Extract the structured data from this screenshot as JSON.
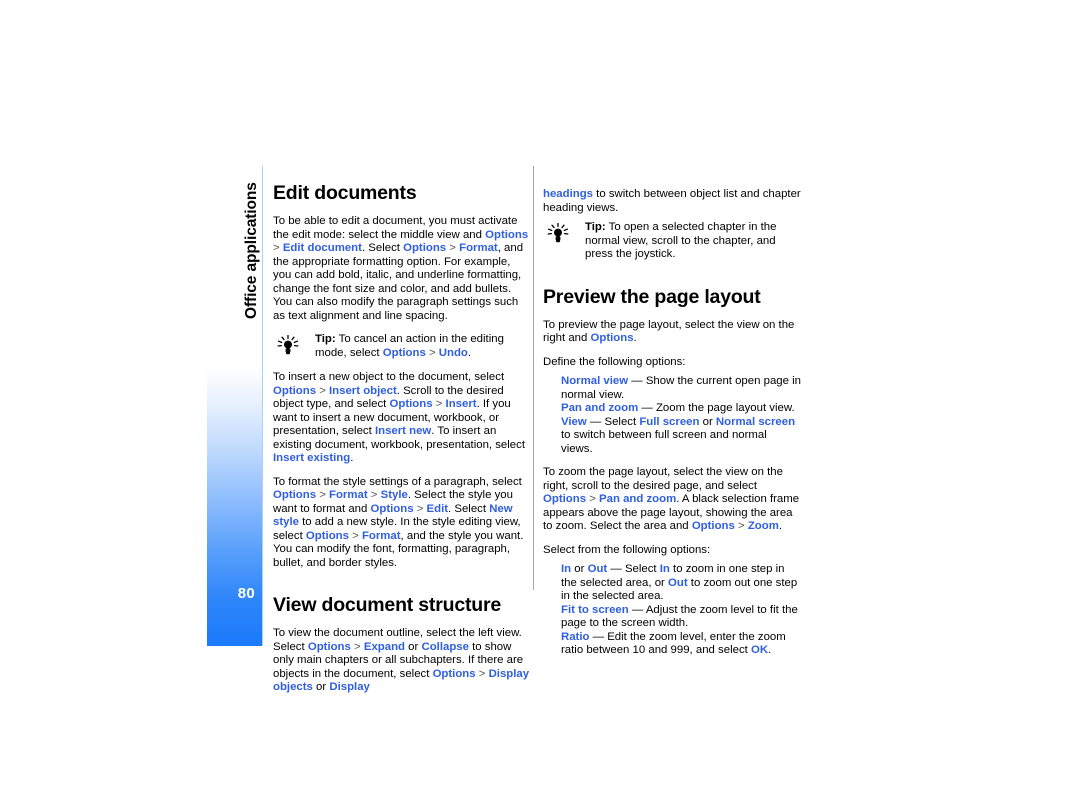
{
  "page": {
    "number": "80",
    "chapter": "Office applications",
    "accent_color": "#2f5fe0",
    "bar_color": "#1a7afc",
    "rule_left_color": "#a8d2f5",
    "rule_mid_color": "#a6a6a6"
  },
  "left_column": {
    "heading1": "Edit documents",
    "p1": [
      {
        "t": "To be able to edit a document, you must activate the edit mode: select the middle view and ",
        "s": "plain"
      },
      {
        "t": "Options",
        "s": "link"
      },
      {
        "t": " > ",
        "s": "gt"
      },
      {
        "t": "Edit document",
        "s": "link"
      },
      {
        "t": ". Select ",
        "s": "plain"
      },
      {
        "t": "Options",
        "s": "link"
      },
      {
        "t": " > ",
        "s": "gt"
      },
      {
        "t": "Format",
        "s": "link"
      },
      {
        "t": ", and the appropriate formatting option. For example, you can add bold, italic, and underline formatting, change the font size and color, and add bullets. You can also modify the paragraph settings such as text alignment and line spacing.",
        "s": "plain"
      }
    ],
    "tip1": [
      {
        "t": "Tip:",
        "s": "bold"
      },
      {
        "t": " To cancel an action in the editing mode, select ",
        "s": "plain"
      },
      {
        "t": "Options",
        "s": "link"
      },
      {
        "t": " > ",
        "s": "gt"
      },
      {
        "t": "Undo",
        "s": "link"
      },
      {
        "t": ".",
        "s": "plain"
      }
    ],
    "p2": [
      {
        "t": "To insert a new object to the document, select ",
        "s": "plain"
      },
      {
        "t": "Options",
        "s": "link"
      },
      {
        "t": " > ",
        "s": "gt"
      },
      {
        "t": "Insert object",
        "s": "link"
      },
      {
        "t": ". Scroll to the desired object type, and select ",
        "s": "plain"
      },
      {
        "t": "Options",
        "s": "link"
      },
      {
        "t": " > ",
        "s": "gt"
      },
      {
        "t": "Insert",
        "s": "link"
      },
      {
        "t": ". If you want to insert a new document, workbook, or presentation, select ",
        "s": "plain"
      },
      {
        "t": "Insert new",
        "s": "link"
      },
      {
        "t": ". To insert an existing document, workbook, presentation, select ",
        "s": "plain"
      },
      {
        "t": "Insert existing",
        "s": "link"
      },
      {
        "t": ".",
        "s": "plain"
      }
    ],
    "p3": [
      {
        "t": "To format the style settings of a paragraph, select ",
        "s": "plain"
      },
      {
        "t": "Options",
        "s": "link"
      },
      {
        "t": " > ",
        "s": "gt"
      },
      {
        "t": "Format",
        "s": "link"
      },
      {
        "t": " > ",
        "s": "gt"
      },
      {
        "t": "Style",
        "s": "link"
      },
      {
        "t": ". Select the style you want to format and ",
        "s": "plain"
      },
      {
        "t": "Options",
        "s": "link"
      },
      {
        "t": " > ",
        "s": "gt"
      },
      {
        "t": "Edit",
        "s": "link"
      },
      {
        "t": ". Select ",
        "s": "plain"
      },
      {
        "t": "New style",
        "s": "link"
      },
      {
        "t": " to add a new style. In the style editing view, select ",
        "s": "plain"
      },
      {
        "t": "Options",
        "s": "link"
      },
      {
        "t": " > ",
        "s": "gt"
      },
      {
        "t": "Format",
        "s": "link"
      },
      {
        "t": ", and the style you want. You can modify the font, formatting, paragraph, bullet, and border styles.",
        "s": "plain"
      }
    ],
    "heading2": "View document structure",
    "p4": [
      {
        "t": "To view the document outline, select the left view. Select ",
        "s": "plain"
      },
      {
        "t": "Options",
        "s": "link"
      },
      {
        "t": " > ",
        "s": "gt"
      },
      {
        "t": "Expand",
        "s": "link"
      },
      {
        "t": " or ",
        "s": "plain"
      },
      {
        "t": "Collapse",
        "s": "link"
      },
      {
        "t": " to show only main chapters or all subchapters. If there are objects in the document, select ",
        "s": "plain"
      },
      {
        "t": "Options",
        "s": "link"
      },
      {
        "t": " > ",
        "s": "gt"
      },
      {
        "t": "Display objects",
        "s": "link"
      },
      {
        "t": " or ",
        "s": "plain"
      },
      {
        "t": "Display",
        "s": "link"
      }
    ]
  },
  "right_column": {
    "p1": [
      {
        "t": "headings",
        "s": "link"
      },
      {
        "t": " to switch between object list and chapter heading views.",
        "s": "plain"
      }
    ],
    "tip1": [
      {
        "t": "Tip:",
        "s": "bold"
      },
      {
        "t": " To open a selected chapter in the normal view, scroll to the chapter, and press the joystick.",
        "s": "plain"
      }
    ],
    "heading1": "Preview the page layout",
    "p2": [
      {
        "t": "To preview the page layout, select the view on the right and ",
        "s": "plain"
      },
      {
        "t": "Options",
        "s": "link"
      },
      {
        "t": ".",
        "s": "plain"
      }
    ],
    "p3": [
      {
        "t": "Define the following options:",
        "s": "plain"
      }
    ],
    "options1": [
      [
        {
          "t": "Normal view",
          "s": "link"
        },
        {
          "t": " — Show the current open page in normal view.",
          "s": "plain"
        }
      ],
      [
        {
          "t": "Pan and zoom",
          "s": "link"
        },
        {
          "t": " — Zoom the page layout view.",
          "s": "plain"
        }
      ],
      [
        {
          "t": "View",
          "s": "link"
        },
        {
          "t": " — Select ",
          "s": "plain"
        },
        {
          "t": "Full screen",
          "s": "link"
        },
        {
          "t": " or ",
          "s": "plain"
        },
        {
          "t": "Normal screen",
          "s": "link"
        },
        {
          "t": " to switch between full screen and normal views.",
          "s": "plain"
        }
      ]
    ],
    "p4": [
      {
        "t": "To zoom the page layout, select the view on the right, scroll to the desired page, and select ",
        "s": "plain"
      },
      {
        "t": "Options",
        "s": "link"
      },
      {
        "t": " > ",
        "s": "gt"
      },
      {
        "t": "Pan and zoom",
        "s": "link"
      },
      {
        "t": ". A black selection frame appears above the page layout, showing the area to zoom. Select the area and ",
        "s": "plain"
      },
      {
        "t": "Options",
        "s": "link"
      },
      {
        "t": " > ",
        "s": "gt"
      },
      {
        "t": "Zoom",
        "s": "link"
      },
      {
        "t": ".",
        "s": "plain"
      }
    ],
    "p5": [
      {
        "t": "Select from the following options:",
        "s": "plain"
      }
    ],
    "options2": [
      [
        {
          "t": "In",
          "s": "link"
        },
        {
          "t": " or ",
          "s": "plain"
        },
        {
          "t": "Out",
          "s": "link"
        },
        {
          "t": " — Select ",
          "s": "plain"
        },
        {
          "t": "In",
          "s": "link"
        },
        {
          "t": " to zoom in one step in the selected area, or ",
          "s": "plain"
        },
        {
          "t": "Out",
          "s": "link"
        },
        {
          "t": " to zoom out one step in the selected area.",
          "s": "plain"
        }
      ],
      [
        {
          "t": "Fit to screen",
          "s": "link"
        },
        {
          "t": " — Adjust the zoom level to fit the page to the screen width.",
          "s": "plain"
        }
      ],
      [
        {
          "t": "Ratio",
          "s": "link"
        },
        {
          "t": " — Edit the zoom level, enter the zoom ratio between 10 and 999, and select ",
          "s": "plain"
        },
        {
          "t": "OK",
          "s": "link"
        },
        {
          "t": ".",
          "s": "plain"
        }
      ]
    ]
  },
  "icons": {
    "tip_icon": "lightbulb-icon"
  }
}
